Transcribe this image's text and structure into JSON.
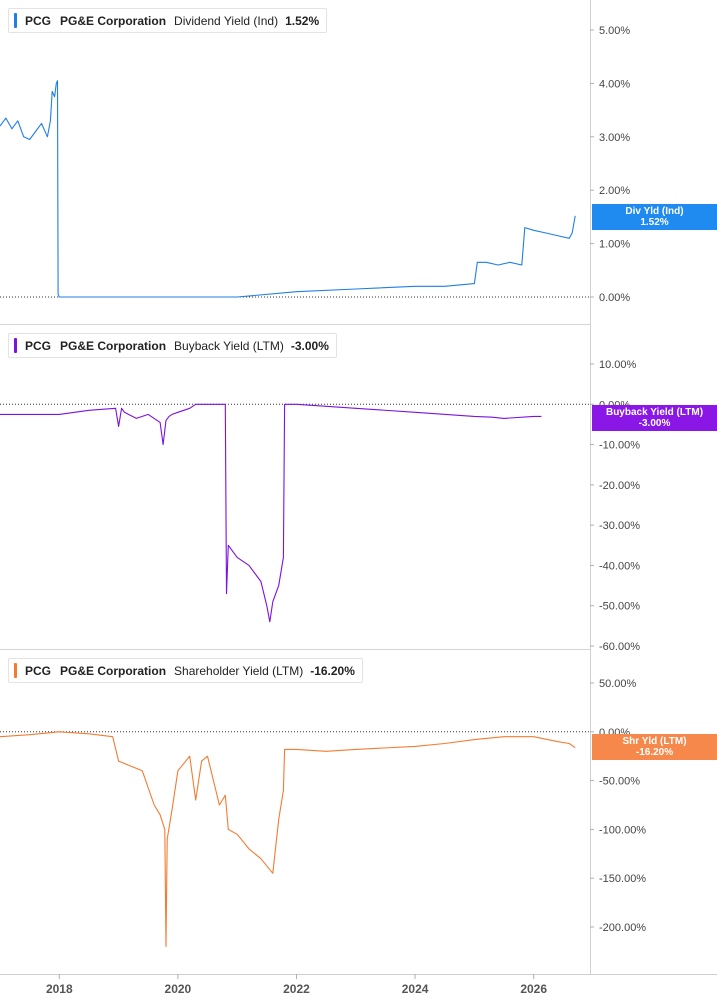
{
  "chart_data": [
    {
      "type": "line",
      "ticker": "PCG",
      "company": "PG&E Corporation",
      "metric": "Dividend Yield (Ind)",
      "latest_value": "1.52%",
      "axis_tag": {
        "label": "Div Yld (Ind)",
        "value": "1.52%"
      },
      "color": "#1f7fe5",
      "y_ticks": [
        {
          "value": 5,
          "label": "5.00%"
        },
        {
          "value": 4,
          "label": "4.00%"
        },
        {
          "value": 3,
          "label": "3.00%"
        },
        {
          "value": 2,
          "label": "2.00%"
        },
        {
          "value": 1,
          "label": "1.00%"
        },
        {
          "value": 0,
          "label": "0.00%"
        }
      ],
      "ylim": [
        0,
        5
      ],
      "zero_line": 0,
      "x": [
        2017.0,
        2017.1,
        2017.2,
        2017.3,
        2017.4,
        2017.5,
        2017.6,
        2017.7,
        2017.8,
        2017.85,
        2017.88,
        2017.92,
        2017.95,
        2017.97,
        2017.98,
        2018.0,
        2019.0,
        2020.0,
        2021.0,
        2022.0,
        2023.0,
        2024.0,
        2024.5,
        2025.0,
        2025.05,
        2025.2,
        2025.4,
        2025.6,
        2025.8,
        2025.85,
        2026.0,
        2026.2,
        2026.4,
        2026.6,
        2026.65,
        2026.7
      ],
      "values": [
        3.2,
        3.35,
        3.15,
        3.3,
        3.0,
        2.95,
        3.1,
        3.25,
        3.0,
        3.3,
        3.85,
        3.75,
        4.0,
        4.05,
        0.05,
        0.0,
        0.0,
        0.0,
        0.0,
        0.1,
        0.15,
        0.2,
        0.2,
        0.25,
        0.65,
        0.65,
        0.6,
        0.65,
        0.6,
        1.3,
        1.25,
        1.2,
        1.15,
        1.1,
        1.2,
        1.52
      ]
    },
    {
      "type": "line",
      "ticker": "PCG",
      "company": "PG&E Corporation",
      "metric": "Buyback Yield (LTM)",
      "latest_value": "-3.00%",
      "axis_tag": {
        "label": "Buyback Yield (LTM)",
        "value": "-3.00%"
      },
      "color": "#7b12e0",
      "y_ticks": [
        {
          "value": 10,
          "label": "10.00%"
        },
        {
          "value": 0,
          "label": "0.00%"
        },
        {
          "value": -10,
          "label": "-10.00%"
        },
        {
          "value": -20,
          "label": "-20.00%"
        },
        {
          "value": -30,
          "label": "-30.00%"
        },
        {
          "value": -40,
          "label": "-40.00%"
        },
        {
          "value": -50,
          "label": "-50.00%"
        },
        {
          "value": -60,
          "label": "-60.00%"
        }
      ],
      "ylim": [
        -60,
        10
      ],
      "zero_line": 0,
      "x": [
        2017.0,
        2017.5,
        2018.0,
        2018.5,
        2018.95,
        2019.0,
        2019.05,
        2019.1,
        2019.3,
        2019.5,
        2019.7,
        2019.75,
        2019.8,
        2019.85,
        2019.9,
        2020.0,
        2020.2,
        2020.3,
        2020.8,
        2020.82,
        2020.85,
        2021.0,
        2021.2,
        2021.4,
        2021.5,
        2021.55,
        2021.6,
        2021.7,
        2021.78,
        2021.8,
        2022.0,
        2023.0,
        2024.0,
        2025.0,
        2025.3,
        2025.5,
        2026.0,
        2026.13
      ],
      "values": [
        -2.5,
        -2.5,
        -2.5,
        -1.5,
        -1.0,
        -5.5,
        -1.0,
        -2.0,
        -3.5,
        -2.5,
        -4.5,
        -10.0,
        -4.0,
        -3.0,
        -2.5,
        -2.0,
        -1.0,
        0.0,
        0.0,
        -47.0,
        -35.0,
        -38.0,
        -40.0,
        -44.0,
        -50.0,
        -54.0,
        -49.0,
        -45.0,
        -38.0,
        0.0,
        0.0,
        -1.0,
        -2.0,
        -3.0,
        -3.2,
        -3.5,
        -3.0,
        -3.0
      ]
    },
    {
      "type": "line",
      "ticker": "PCG",
      "company": "PG&E Corporation",
      "metric": "Shareholder Yield (LTM)",
      "latest_value": "-16.20%",
      "axis_tag": {
        "label": "Shr Yld (LTM)",
        "value": "-16.20%"
      },
      "color": "#f47b32",
      "y_ticks": [
        {
          "value": 50,
          "label": "50.00%"
        },
        {
          "value": 0,
          "label": "0.00%"
        },
        {
          "value": -50,
          "label": "-50.00%"
        },
        {
          "value": -100,
          "label": "-100.00%"
        },
        {
          "value": -150,
          "label": "-150.00%"
        },
        {
          "value": -200,
          "label": "-200.00%"
        }
      ],
      "ylim": [
        -225,
        60
      ],
      "zero_line": 0,
      "x": [
        2017.0,
        2017.5,
        2018.0,
        2018.5,
        2018.9,
        2019.0,
        2019.2,
        2019.4,
        2019.6,
        2019.7,
        2019.78,
        2019.8,
        2019.82,
        2019.9,
        2020.0,
        2020.2,
        2020.3,
        2020.4,
        2020.5,
        2020.7,
        2020.8,
        2020.85,
        2021.0,
        2021.2,
        2021.4,
        2021.6,
        2021.7,
        2021.78,
        2021.8,
        2022.0,
        2022.5,
        2023.0,
        2024.0,
        2024.5,
        2025.0,
        2025.5,
        2026.0,
        2026.4,
        2026.6,
        2026.7
      ],
      "values": [
        -5.0,
        -3.0,
        0.0,
        -2.0,
        -5.0,
        -30.0,
        -35.0,
        -40.0,
        -75.0,
        -85.0,
        -100.0,
        -220.0,
        -110.0,
        -80.0,
        -40.0,
        -25.0,
        -70.0,
        -30.0,
        -25.0,
        -75.0,
        -65.0,
        -100.0,
        -105.0,
        -120.0,
        -130.0,
        -145.0,
        -90.0,
        -60.0,
        -18.0,
        -18.0,
        -20.0,
        -18.0,
        -15.0,
        -12.0,
        -8.0,
        -5.0,
        -5.0,
        -10.0,
        -12.0,
        -16.2
      ]
    }
  ],
  "x_axis": {
    "range": [
      2017.0,
      2026.95
    ],
    "ticks": [
      {
        "value": 2018,
        "label": "2018"
      },
      {
        "value": 2020,
        "label": "2020"
      },
      {
        "value": 2022,
        "label": "2022"
      },
      {
        "value": 2024,
        "label": "2024"
      },
      {
        "value": 2026,
        "label": "2026"
      }
    ]
  }
}
